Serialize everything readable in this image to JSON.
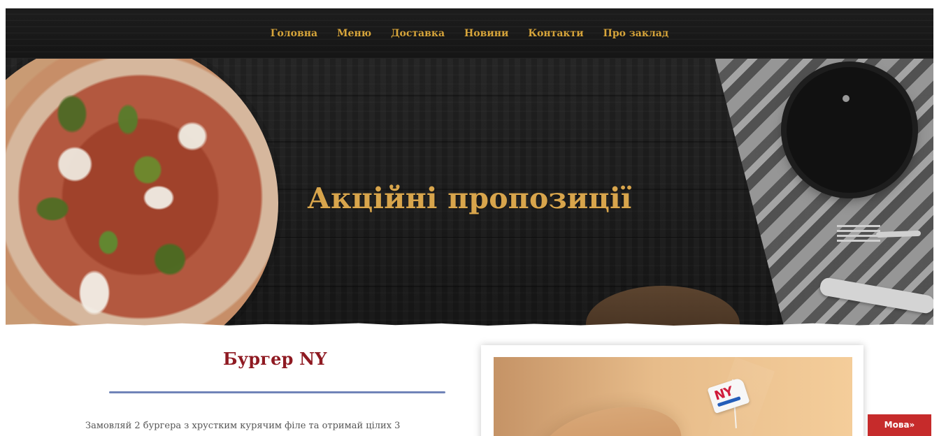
{
  "nav": {
    "items": [
      {
        "label": "Головна"
      },
      {
        "label": "Меню"
      },
      {
        "label": "Доставка"
      },
      {
        "label": "Новини"
      },
      {
        "label": "Контакти"
      },
      {
        "label": "Про заклад"
      }
    ]
  },
  "hero": {
    "title": "Акційні пропозиції"
  },
  "main": {
    "title": "Бургер NY",
    "text": "Замовляй 2 бургера з хрустким курячим філе та отримай цілих 3"
  },
  "promo": {
    "flag_text": "NY"
  },
  "language": {
    "button_label": "Мова»"
  },
  "colors": {
    "topbar": "#1d1d1d",
    "nav_text": "#d7a53b",
    "hero_title": "#d8a54c",
    "content_title": "#8f1a22",
    "divider": "#7084b8",
    "body_text": "#555555",
    "button_bg": "#c62b2b",
    "button_text": "#ffffff"
  },
  "icons": {
    "pizza": "pizza-image",
    "plate": "plate-image",
    "fork": "fork-icon",
    "knife": "knife-icon",
    "flag": "flag-icon"
  }
}
